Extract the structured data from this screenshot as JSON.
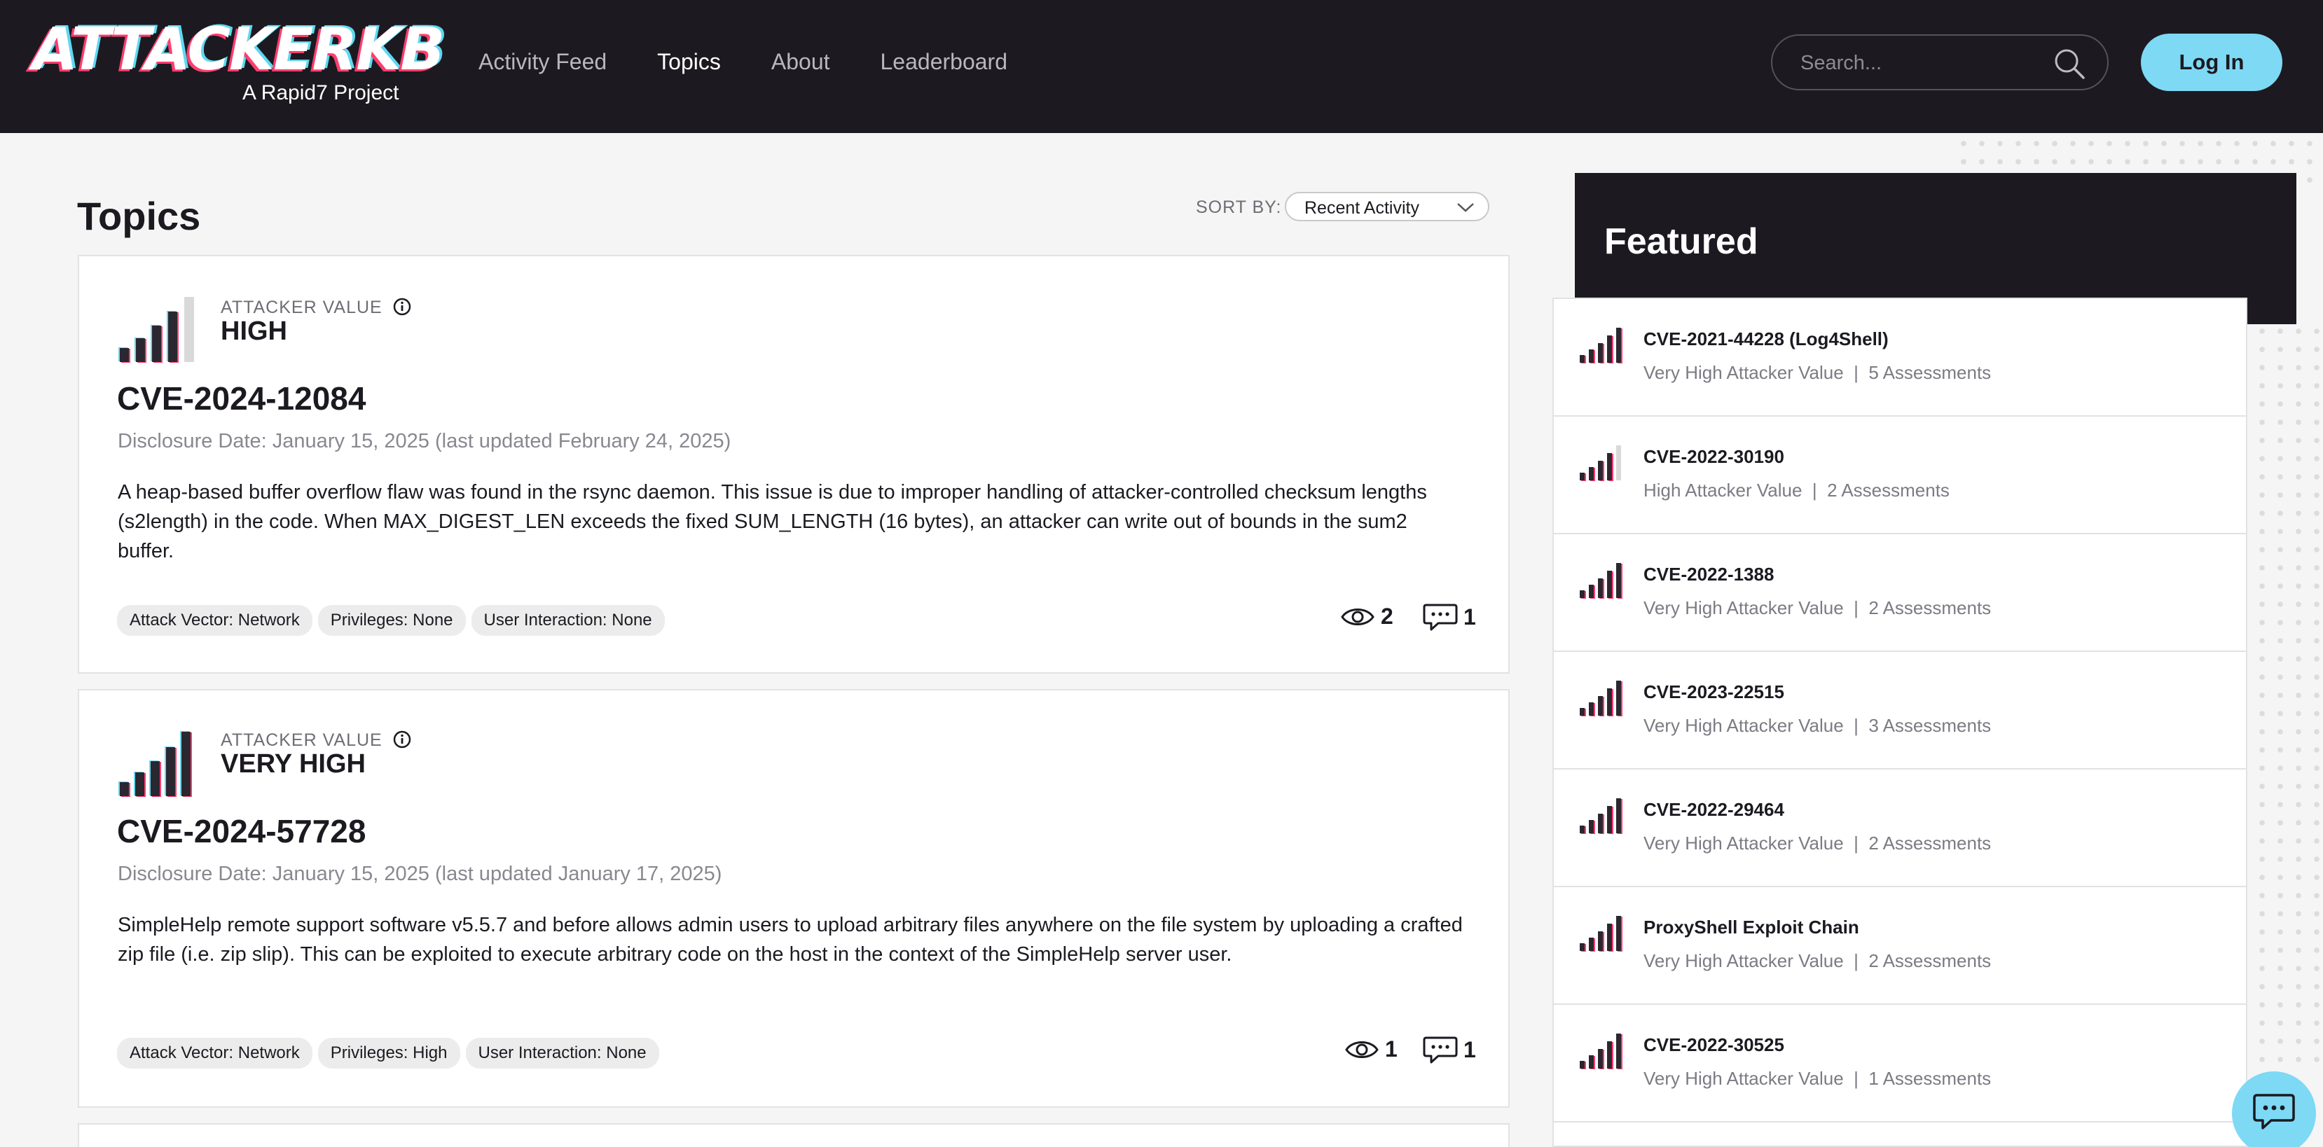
{
  "header": {
    "logo_text": "ATTACKERKB",
    "logo_sub": "A Rapid7 Project",
    "nav": [
      "Activity Feed",
      "Topics",
      "About",
      "Leaderboard"
    ],
    "active_nav": "Topics",
    "search_placeholder": "Search...",
    "search_icon": "search-icon",
    "login_label": "Log In"
  },
  "main": {
    "title": "Topics",
    "sort_label": "SORT BY:",
    "sort_value": "Recent Activity",
    "topics": [
      {
        "attacker_value_label": "ATTACKER VALUE",
        "attacker_value": "HIGH",
        "bars_filled": 4,
        "title": "CVE-2024-12084",
        "disclosure": "Disclosure Date: January 15, 2025 (last updated February 24, 2025)",
        "description": "A heap-based buffer overflow flaw was found in the rsync daemon. This issue is due to improper handling of attacker-controlled checksum lengths (s2length) in the code. When MAX_DIGEST_LEN exceeds the fixed SUM_LENGTH (16 bytes), an attacker can write out of bounds in the sum2 buffer.",
        "tags": [
          "Attack Vector: Network",
          "Privileges: None",
          "User Interaction: None"
        ],
        "views": "2",
        "comments": "1"
      },
      {
        "attacker_value_label": "ATTACKER VALUE",
        "attacker_value": "VERY HIGH",
        "bars_filled": 5,
        "title": "CVE-2024-57728",
        "disclosure": "Disclosure Date: January 15, 2025 (last updated January 17, 2025)",
        "description": "SimpleHelp remote support software v5.5.7 and before allows admin users to upload arbitrary files anywhere on the file system by uploading a crafted zip file (i.e. zip slip). This can be exploited to execute arbitrary code on the host in the context of the SimpleHelp server user.",
        "tags": [
          "Attack Vector: Network",
          "Privileges: High",
          "User Interaction: None"
        ],
        "views": "1",
        "comments": "1"
      }
    ]
  },
  "featured": {
    "title": "Featured",
    "items": [
      {
        "name": "CVE-2021-44228 (Log4Shell)",
        "value": "Very High Attacker Value",
        "assessments": "5 Assessments",
        "bars_filled": 5
      },
      {
        "name": "CVE-2022-30190",
        "value": "High Attacker Value",
        "assessments": "2 Assessments",
        "bars_filled": 4
      },
      {
        "name": "CVE-2022-1388",
        "value": "Very High Attacker Value",
        "assessments": "2 Assessments",
        "bars_filled": 5
      },
      {
        "name": "CVE-2023-22515",
        "value": "Very High Attacker Value",
        "assessments": "3 Assessments",
        "bars_filled": 5
      },
      {
        "name": "CVE-2022-29464",
        "value": "Very High Attacker Value",
        "assessments": "2 Assessments",
        "bars_filled": 5
      },
      {
        "name": "ProxyShell Exploit Chain",
        "value": "Very High Attacker Value",
        "assessments": "2 Assessments",
        "bars_filled": 5
      },
      {
        "name": "CVE-2022-30525",
        "value": "Very High Attacker Value",
        "assessments": "1 Assessments",
        "bars_filled": 5
      }
    ]
  },
  "colors": {
    "header_bg": "#1c1a20",
    "accent_cyan": "#7ed9f5",
    "accent_red": "#ff3d6f"
  },
  "chat_icon": "chat-icon"
}
